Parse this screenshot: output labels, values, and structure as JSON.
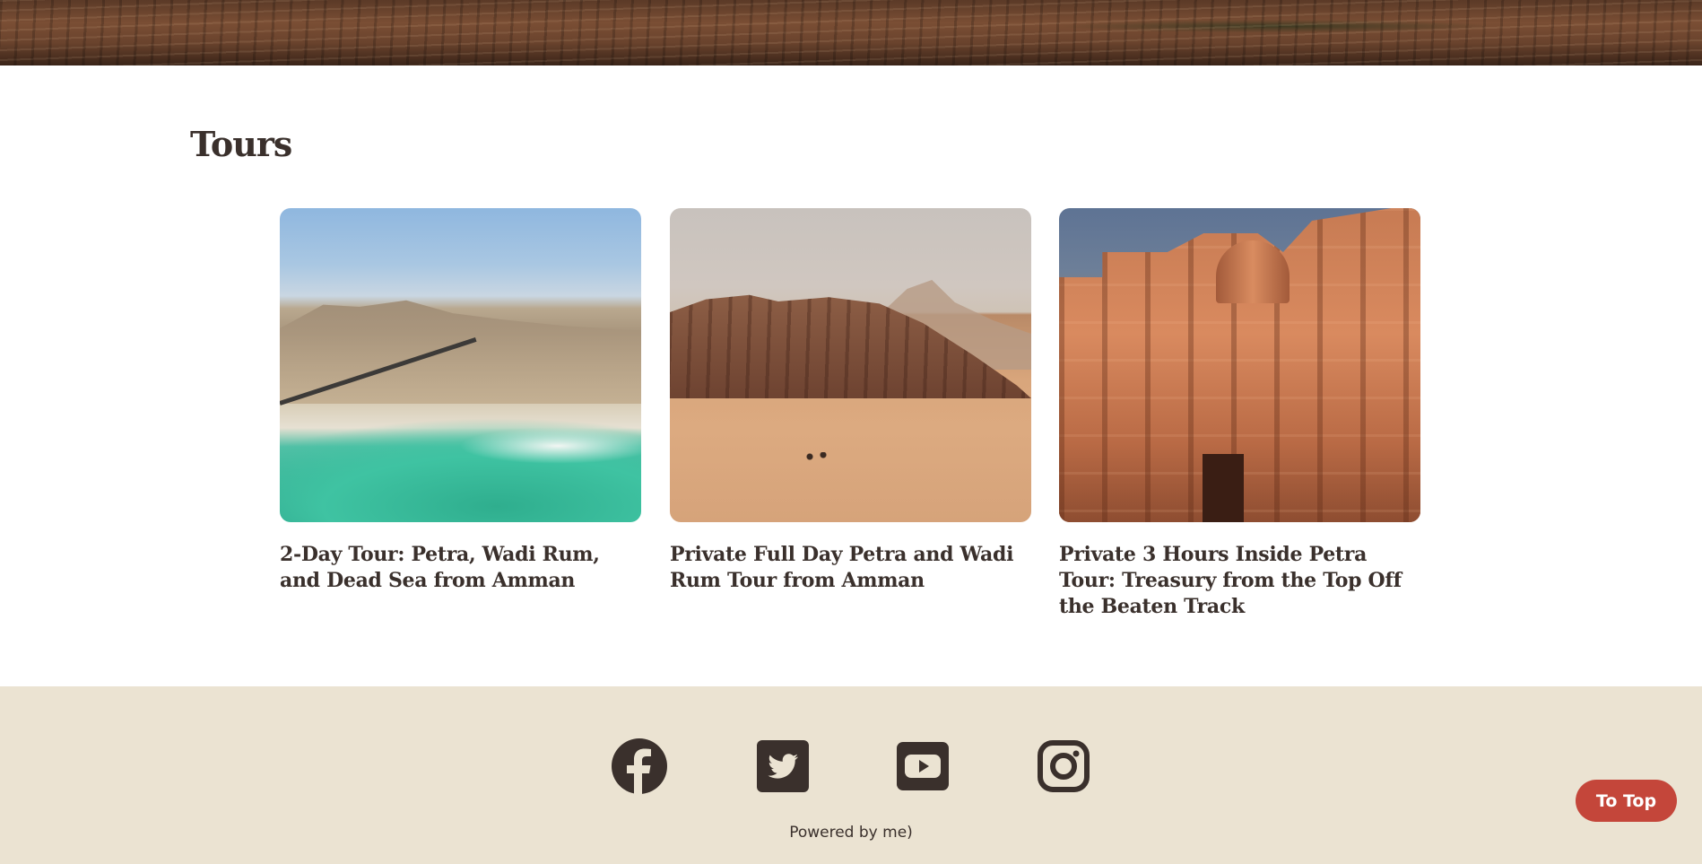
{
  "tours": {
    "title": "Tours",
    "items": [
      {
        "title": "2-Day Tour: Petra, Wadi Rum, and Dead Sea from Amman",
        "image": "dead-sea-coast-photo"
      },
      {
        "title": "Private Full Day Petra and Wadi Rum Tour from Amman",
        "image": "wadi-rum-desert-photo"
      },
      {
        "title": "Private 3 Hours Inside Petra Tour: Treasury from the Top Off the Beaten Track",
        "image": "petra-monastery-photo"
      }
    ]
  },
  "footer": {
    "social": [
      {
        "icon": "facebook-icon"
      },
      {
        "icon": "twitter-icon"
      },
      {
        "icon": "youtube-icon"
      },
      {
        "icon": "instagram-icon"
      }
    ],
    "powered_by": "Powered by me)"
  },
  "to_top": {
    "label": "To Top",
    "color": "#c4463a"
  },
  "colors": {
    "text": "#3a302c",
    "footer_bg": "#ebe3d2",
    "page_bg": "#ffffff"
  }
}
